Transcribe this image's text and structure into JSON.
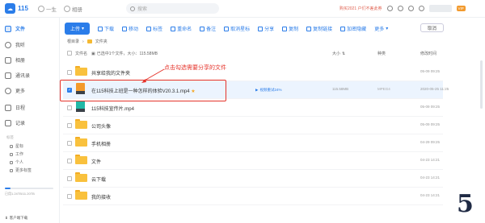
{
  "topbar": {
    "logo": "115",
    "nav": [
      {
        "label": "一生"
      },
      {
        "label": "相册"
      }
    ],
    "search_placeholder": "搜索",
    "promo_text": "购买2021 户们不差此券",
    "vip_label": "VIP"
  },
  "sidebar": {
    "items": [
      {
        "label": "文件",
        "icon": "file-icon"
      },
      {
        "label": "我听",
        "icon": "headphone-icon"
      },
      {
        "label": "相册",
        "icon": "photo-icon"
      },
      {
        "label": "通讯录",
        "icon": "contacts-icon"
      },
      {
        "label": "更多",
        "icon": "more-icon"
      },
      {
        "label": "日程",
        "icon": "calendar-icon"
      },
      {
        "label": "记录",
        "icon": "note-icon"
      }
    ],
    "section_label": "标签",
    "subs": [
      {
        "label": "星标"
      },
      {
        "label": "工作"
      },
      {
        "label": "个人"
      },
      {
        "label": "更多标签"
      }
    ],
    "storage_text": "已用1.24TB/11.20TB",
    "storage_fraction": 0.11,
    "client_download": "客户端下载"
  },
  "toolbar": {
    "upload": "上传",
    "items": [
      "下载",
      "移动",
      "标签",
      "重命名",
      "备注",
      "取消星标",
      "分享",
      "复制",
      "复制链接",
      "加密隐藏",
      "更多"
    ],
    "cancel": "取消"
  },
  "breadcrumb": {
    "root": "根目录",
    "current": "文件夹"
  },
  "header": {
    "name": "文件名",
    "select_info": "已选中1个文件，大小：115.58MB",
    "size": "大小",
    "type": "种类",
    "time": "修改时间"
  },
  "annotation": "点击勾选需要分享的文件",
  "rows": [
    {
      "name": "共享给我的文件夹",
      "size": "",
      "type": "",
      "time": "05-09 09:25",
      "kind": "folder"
    },
    {
      "name": "在115科技上班是一种怎样的体验V20.3.1.mp4",
      "size": "115.58MB",
      "type": "MPEG4",
      "time": "2020-05-25 11:25",
      "kind": "video",
      "progress": "视频重试24%"
    },
    {
      "name": "115科技宣传片.mp4",
      "size": "",
      "type": "",
      "time": "05-09 09:25",
      "kind": "video"
    },
    {
      "name": "公司头像",
      "size": "",
      "type": "",
      "time": "05-09 09:25",
      "kind": "folder"
    },
    {
      "name": "手机相册",
      "size": "",
      "type": "",
      "time": "04-29 09:25",
      "kind": "folder"
    },
    {
      "name": "文件",
      "size": "",
      "type": "",
      "time": "04-23 14:21",
      "kind": "folder"
    },
    {
      "name": "云下载",
      "size": "",
      "type": "",
      "time": "04-23 14:21",
      "kind": "folder"
    },
    {
      "name": "我的接收",
      "size": "",
      "type": "",
      "time": "04-23 14:21",
      "kind": "folder"
    }
  ],
  "corner_mark": "5",
  "colors": {
    "accent": "#2b7de9",
    "highlight": "#e5332a",
    "folder": "#f9c13d",
    "selected_row": "#ecf4fe"
  }
}
